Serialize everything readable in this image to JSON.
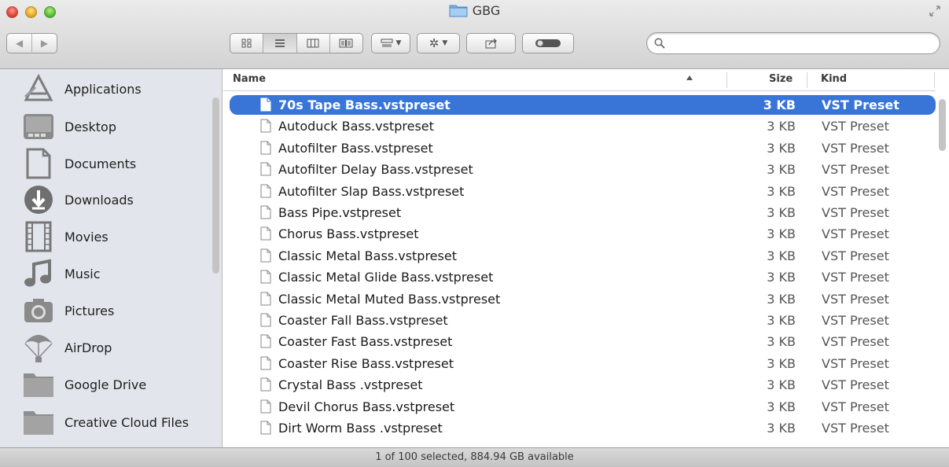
{
  "window": {
    "title": "GBG"
  },
  "toolbar": {
    "search_placeholder": ""
  },
  "sidebar": {
    "items": [
      {
        "label": "Applications",
        "icon": "applications-icon"
      },
      {
        "label": "Desktop",
        "icon": "desktop-icon"
      },
      {
        "label": "Documents",
        "icon": "documents-icon"
      },
      {
        "label": "Downloads",
        "icon": "downloads-icon"
      },
      {
        "label": "Movies",
        "icon": "movies-icon"
      },
      {
        "label": "Music",
        "icon": "music-icon"
      },
      {
        "label": "Pictures",
        "icon": "pictures-icon"
      },
      {
        "label": "AirDrop",
        "icon": "airdrop-icon"
      },
      {
        "label": "Google Drive",
        "icon": "folder-icon"
      },
      {
        "label": "Creative Cloud Files",
        "icon": "folder-icon"
      }
    ]
  },
  "list": {
    "columns": {
      "name": "Name",
      "size": "Size",
      "kind": "Kind"
    },
    "selected_color": "#3875d7",
    "rows": [
      {
        "name": "70s Tape Bass.vstpreset",
        "size": "3 KB",
        "kind": "VST Preset",
        "selected": true
      },
      {
        "name": "Autoduck Bass.vstpreset",
        "size": "3 KB",
        "kind": "VST Preset"
      },
      {
        "name": "Autofilter Bass.vstpreset",
        "size": "3 KB",
        "kind": "VST Preset"
      },
      {
        "name": "Autofilter Delay Bass.vstpreset",
        "size": "3 KB",
        "kind": "VST Preset"
      },
      {
        "name": "Autofilter Slap Bass.vstpreset",
        "size": "3 KB",
        "kind": "VST Preset"
      },
      {
        "name": "Bass Pipe.vstpreset",
        "size": "3 KB",
        "kind": "VST Preset"
      },
      {
        "name": "Chorus Bass.vstpreset",
        "size": "3 KB",
        "kind": "VST Preset"
      },
      {
        "name": "Classic Metal Bass.vstpreset",
        "size": "3 KB",
        "kind": "VST Preset"
      },
      {
        "name": "Classic Metal Glide Bass.vstpreset",
        "size": "3 KB",
        "kind": "VST Preset"
      },
      {
        "name": "Classic Metal Muted Bass.vstpreset",
        "size": "3 KB",
        "kind": "VST Preset"
      },
      {
        "name": "Coaster Fall Bass.vstpreset",
        "size": "3 KB",
        "kind": "VST Preset"
      },
      {
        "name": "Coaster Fast Bass.vstpreset",
        "size": "3 KB",
        "kind": "VST Preset"
      },
      {
        "name": "Coaster Rise Bass.vstpreset",
        "size": "3 KB",
        "kind": "VST Preset"
      },
      {
        "name": "Crystal Bass .vstpreset",
        "size": "3 KB",
        "kind": "VST Preset"
      },
      {
        "name": "Devil Chorus Bass.vstpreset",
        "size": "3 KB",
        "kind": "VST Preset"
      },
      {
        "name": "Dirt Worm Bass .vstpreset",
        "size": "3 KB",
        "kind": "VST Preset"
      }
    ]
  },
  "status": {
    "text": "1 of 100 selected, 884.94 GB available"
  }
}
